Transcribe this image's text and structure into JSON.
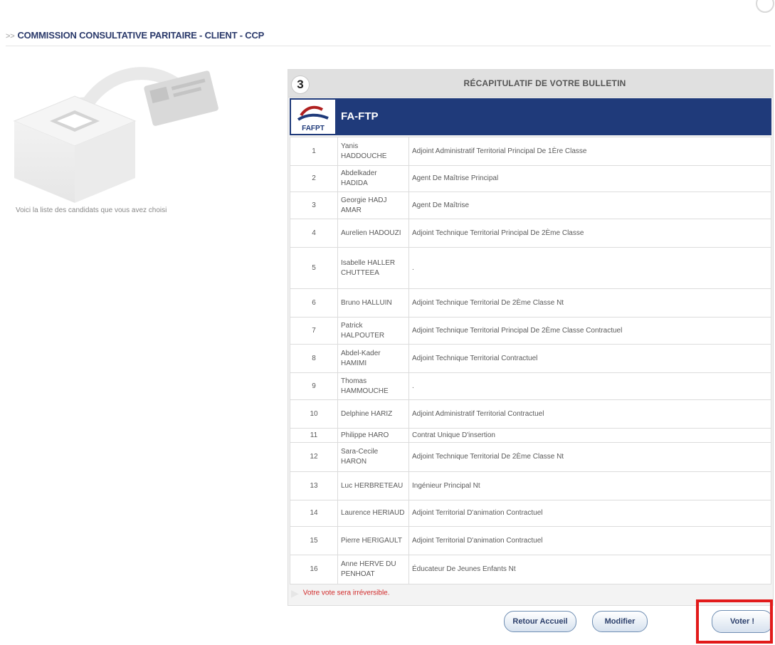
{
  "header": {
    "title": "COMMISSION CONSULTATIVE PARITAIRE - CLIENT - CCP"
  },
  "left": {
    "caption": "Voici la liste des candidats que vous avez choisi"
  },
  "recap": {
    "step": "3",
    "title": "RÉCAPITULATIF DE VOTRE BULLETIN",
    "list_name": "FA-FTP",
    "logo_text": "FAFPT",
    "candidates": [
      {
        "num": "1",
        "name": "Yanis HADDOUCHE",
        "grade": "Adjoint Administratif Territorial Principal De 1Ère Classe"
      },
      {
        "num": "2",
        "name": "Abdelkader HADIDA",
        "grade": "Agent De Maîtrise Principal"
      },
      {
        "num": "3",
        "name": "Georgie HADJ AMAR",
        "grade": "Agent De Maîtrise"
      },
      {
        "num": "4",
        "name": "Aurelien HADOUZI",
        "grade": "Adjoint Technique Territorial Principal De 2Ème Classe"
      },
      {
        "num": "5",
        "name": "Isabelle HALLER CHUTTEEA",
        "grade": "."
      },
      {
        "num": "6",
        "name": "Bruno HALLUIN",
        "grade": "Adjoint Technique Territorial De 2Ème Classe Nt"
      },
      {
        "num": "7",
        "name": "Patrick HALPOUTER",
        "grade": "Adjoint Technique Territorial Principal De 2Ème Classe Contractuel"
      },
      {
        "num": "8",
        "name": "Abdel-Kader HAMIMI",
        "grade": "Adjoint Technique Territorial Contractuel"
      },
      {
        "num": "9",
        "name": "Thomas HAMMOUCHE",
        "grade": "."
      },
      {
        "num": "10",
        "name": "Delphine HARIZ",
        "grade": "Adjoint Administratif Territorial Contractuel"
      },
      {
        "num": "11",
        "name": "Philippe HARO",
        "grade": "Contrat Unique D'insertion"
      },
      {
        "num": "12",
        "name": "Sara-Cecile HARON",
        "grade": "Adjoint Technique Territorial De 2Ème Classe Nt"
      },
      {
        "num": "13",
        "name": "Luc HERBRETEAU",
        "grade": "Ingénieur Principal Nt"
      },
      {
        "num": "14",
        "name": "Laurence HERIAUD",
        "grade": "Adjoint Territorial D'animation Contractuel"
      },
      {
        "num": "15",
        "name": "Pierre HERIGAULT",
        "grade": "Adjoint Territorial D'animation Contractuel"
      },
      {
        "num": "16",
        "name": "Anne HERVE DU PENHOAT",
        "grade": "Éducateur De Jeunes Enfants Nt"
      }
    ],
    "warning": "Votre vote sera irréversible."
  },
  "buttons": {
    "retour": "Retour Accueil",
    "modifier": "Modifier",
    "voter": "Voter !"
  },
  "colors": {
    "list_header_bg": "#1f3a7a",
    "highlight": "#e21a1a",
    "warning_text": "#d12b2b"
  }
}
